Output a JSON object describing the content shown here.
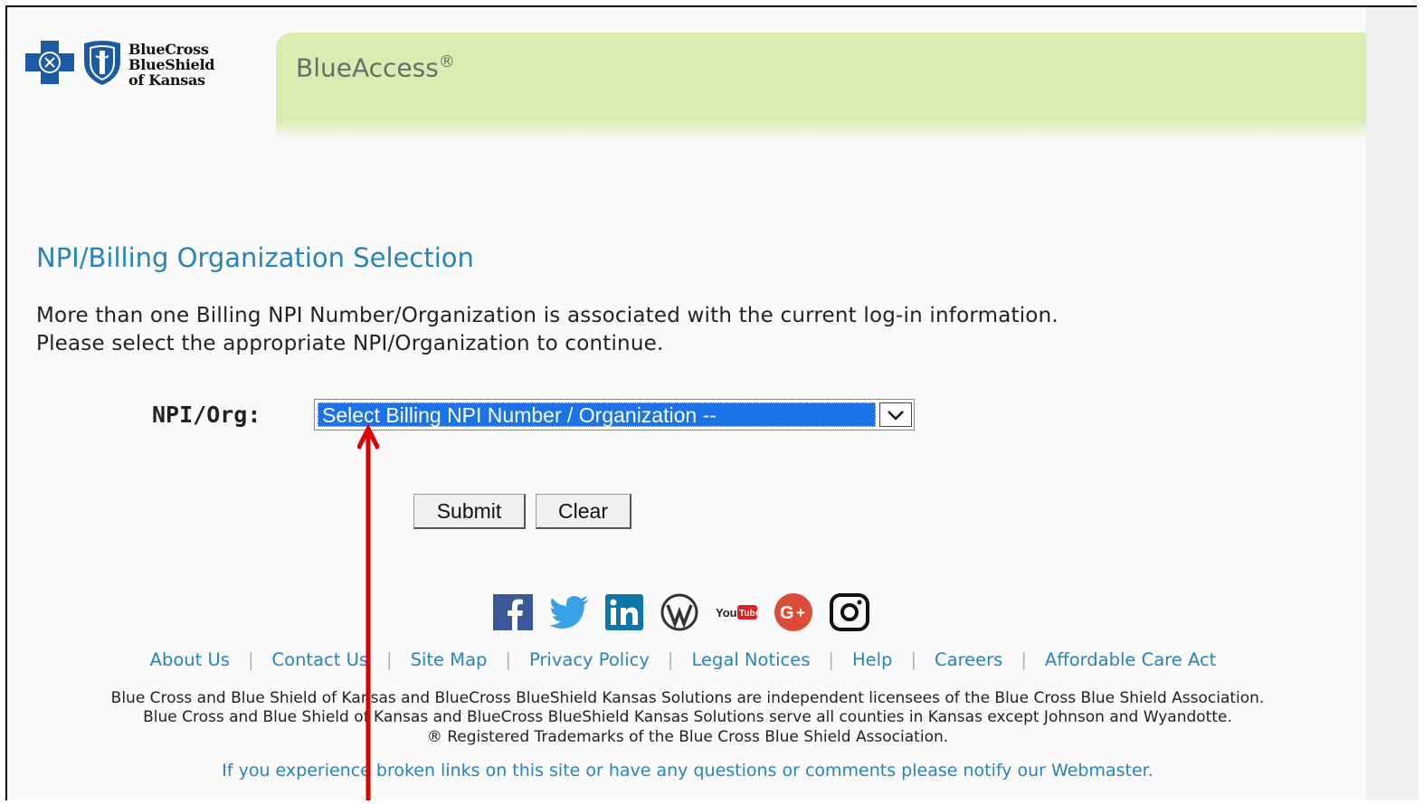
{
  "brand": {
    "logo_text_line1": "BlueCross",
    "logo_text_line2": "BlueShield",
    "logo_text_line3": "of Kansas",
    "app_name": "BlueAccess",
    "app_mark": "®"
  },
  "page": {
    "title": "NPI/Billing Organization Selection",
    "intro_line1": "More than one Billing NPI Number/Organization is associated with the current log-in information.",
    "intro_line2": "Please select the appropriate NPI/Organization to continue."
  },
  "form": {
    "npi_label": "NPI/Org:",
    "npi_select_value": "Select Billing NPI Number / Organization --",
    "submit_label": "Submit",
    "clear_label": "Clear"
  },
  "social_icons": [
    "facebook-icon",
    "twitter-icon",
    "linkedin-icon",
    "wordpress-icon",
    "youtube-icon",
    "google-plus-icon",
    "instagram-icon"
  ],
  "footer": {
    "links": [
      "About Us",
      "Contact Us",
      "Site Map",
      "Privacy Policy",
      "Legal Notices",
      "Help",
      "Careers",
      "Affordable Care Act"
    ],
    "legal_line1": "Blue Cross and Blue Shield of Kansas and BlueCross BlueShield Kansas Solutions are independent licensees of the Blue Cross Blue Shield Association.",
    "legal_line2": "Blue Cross and Blue Shield of Kansas and BlueCross BlueShield Kansas Solutions serve all counties in Kansas except Johnson and Wyandotte.",
    "legal_line3": "® Registered Trademarks of the Blue Cross Blue Shield Association.",
    "notify": "If you experience broken links on this site or have any questions or comments please notify our Webmaster."
  },
  "colors": {
    "accent": "#2a83b5",
    "banner": "#d9edb0",
    "select_highlight": "#1a73e8",
    "annotation_arrow": "#e00000"
  }
}
